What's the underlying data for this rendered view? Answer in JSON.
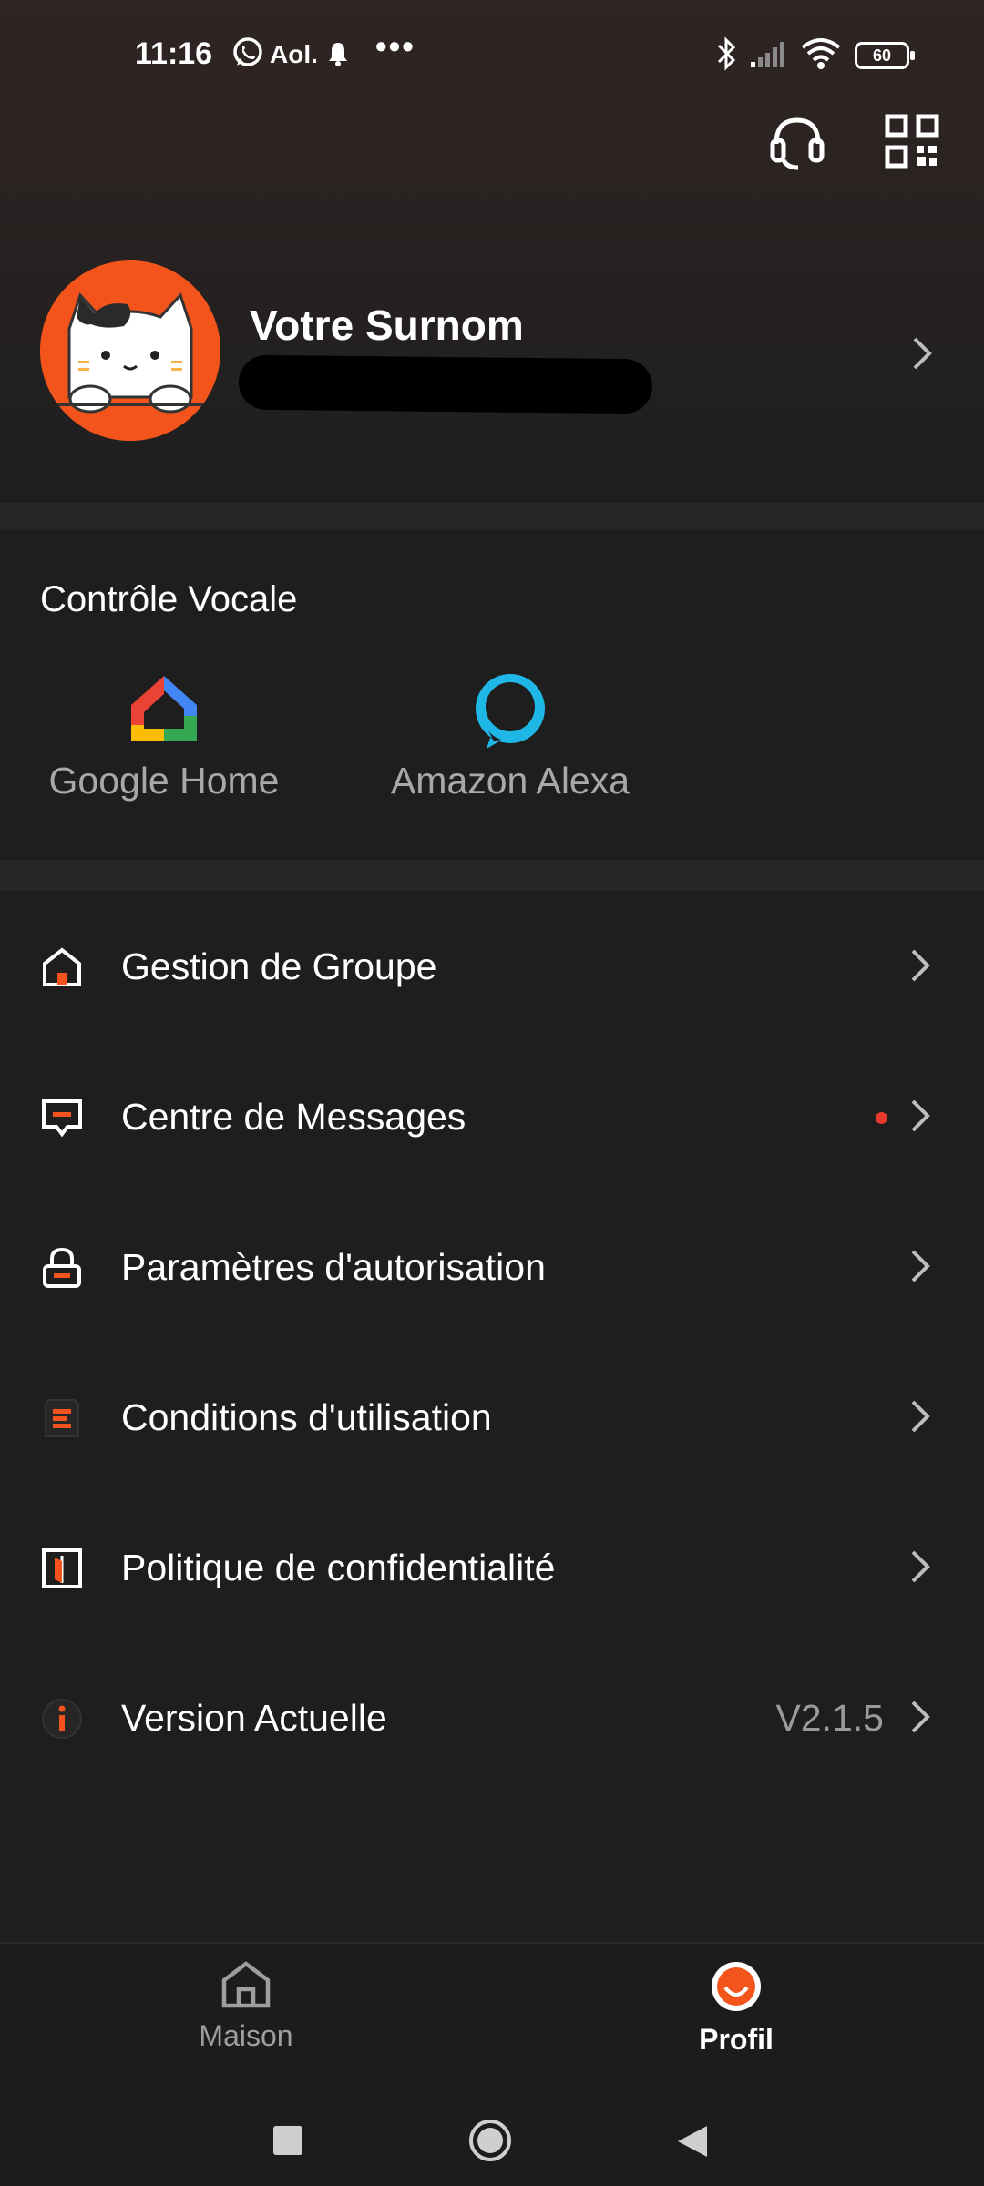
{
  "status_bar": {
    "time": "11:16",
    "carrier_text": "Aol.",
    "more": "•••",
    "battery": "60"
  },
  "header": {
    "support_icon": "headset-icon",
    "scan_icon": "qr-code-icon"
  },
  "profile": {
    "nickname": "Votre Surnom",
    "avatar": "cat-avatar"
  },
  "voice_control": {
    "title": "Contrôle Vocale",
    "items": [
      {
        "label": "Google Home",
        "icon": "google-home-icon"
      },
      {
        "label": "Amazon Alexa",
        "icon": "alexa-icon"
      }
    ]
  },
  "menu": {
    "items": [
      {
        "label": "Gestion de Groupe",
        "icon": "house-icon"
      },
      {
        "label": "Centre de Messages",
        "icon": "message-icon"
      },
      {
        "label": "Paramètres d'autorisation",
        "icon": "lock-icon"
      },
      {
        "label": "Conditions d'utilisation",
        "icon": "document-icon"
      },
      {
        "label": "Politique de confidentialité",
        "icon": "book-icon"
      },
      {
        "label": "Version Actuelle",
        "icon": "info-icon",
        "value": "V2.1.5"
      }
    ],
    "accent_color": "#f2541b",
    "notification_dot_color": "#e8392f"
  },
  "bottom_nav": {
    "items": [
      {
        "label": "Maison",
        "icon": "home-icon",
        "active": false
      },
      {
        "label": "Profil",
        "icon": "profile-icon",
        "active": true
      }
    ]
  },
  "system_nav": {
    "recent": "square-icon",
    "home": "circle-icon",
    "back": "triangle-back-icon"
  }
}
